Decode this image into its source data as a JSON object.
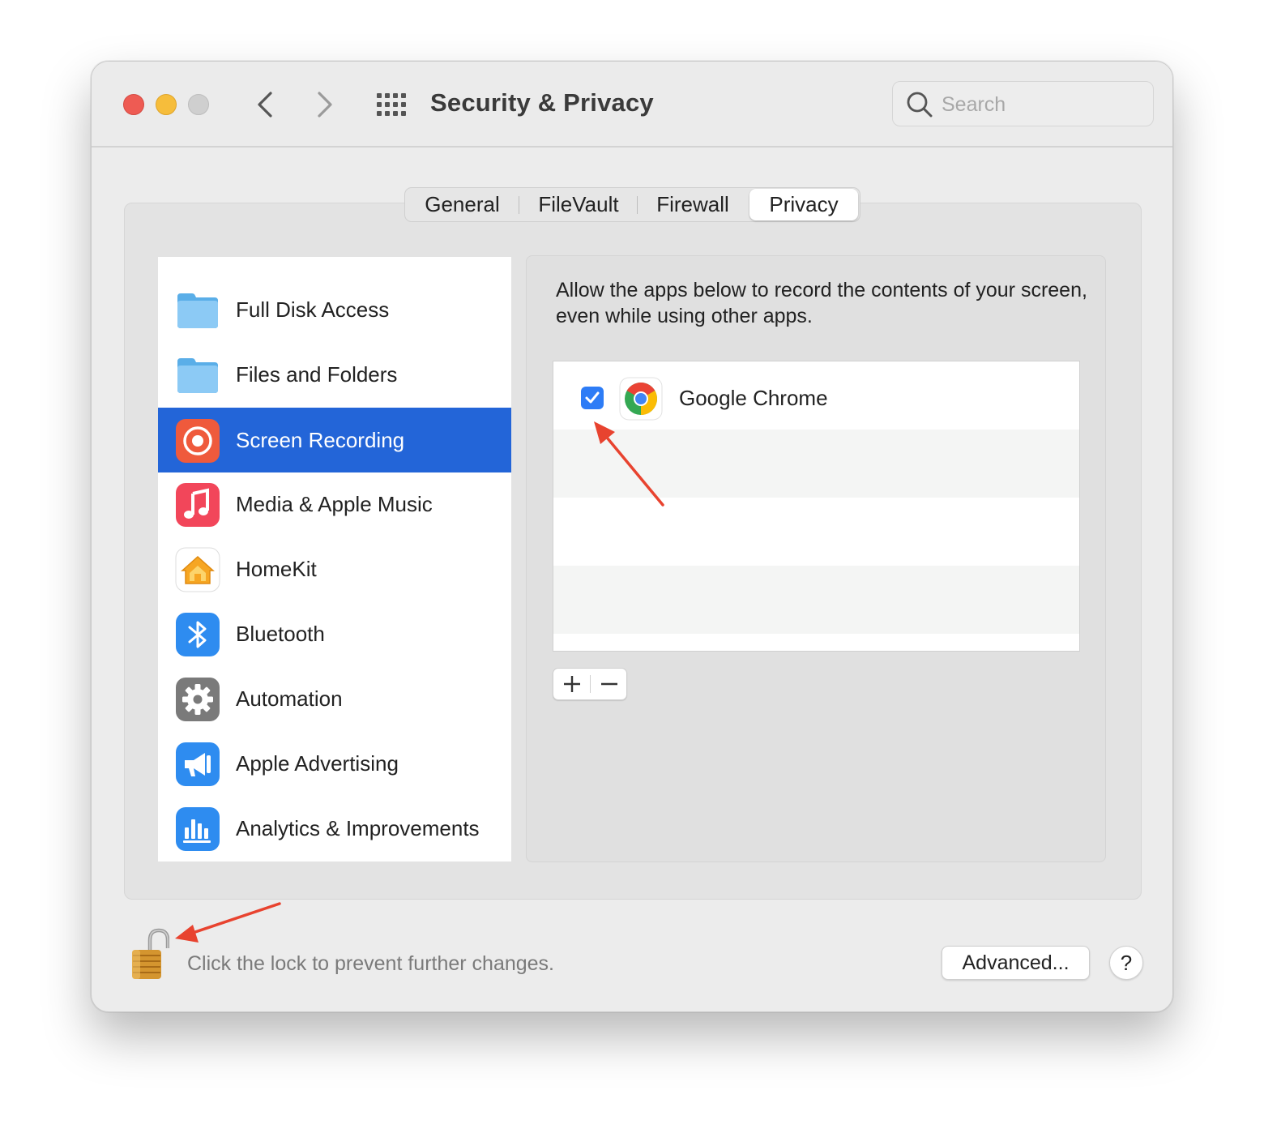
{
  "window": {
    "title": "Security & Privacy",
    "search": {
      "placeholder": "Search",
      "value": ""
    }
  },
  "tabs": [
    {
      "label": "General",
      "active": false
    },
    {
      "label": "FileVault",
      "active": false
    },
    {
      "label": "Firewall",
      "active": false
    },
    {
      "label": "Privacy",
      "active": true
    }
  ],
  "sidebar": {
    "items": [
      {
        "label": "Full Disk Access",
        "icon": "folder-icon",
        "selected": false
      },
      {
        "label": "Files and Folders",
        "icon": "folder-icon",
        "selected": false
      },
      {
        "label": "Screen Recording",
        "icon": "screen-recording-icon",
        "selected": true
      },
      {
        "label": "Media & Apple Music",
        "icon": "music-icon",
        "selected": false
      },
      {
        "label": "HomeKit",
        "icon": "homekit-icon",
        "selected": false
      },
      {
        "label": "Bluetooth",
        "icon": "bluetooth-icon",
        "selected": false
      },
      {
        "label": "Automation",
        "icon": "gear-icon",
        "selected": false
      },
      {
        "label": "Apple Advertising",
        "icon": "megaphone-icon",
        "selected": false
      },
      {
        "label": "Analytics & Improvements",
        "icon": "analytics-icon",
        "selected": false
      }
    ]
  },
  "panel": {
    "description": "Allow the apps below to record the contents of your screen, even while using other apps.",
    "apps": [
      {
        "name": "Google Chrome",
        "checked": true,
        "icon": "chrome-icon"
      }
    ],
    "add_symbol": "+",
    "remove_symbol": "−"
  },
  "footer": {
    "lock_text": "Click the lock to prevent further changes.",
    "lock_state": "unlocked",
    "advanced_label": "Advanced...",
    "help_label": "?"
  },
  "colors": {
    "accent_selected": "#2365d8",
    "checkbox": "#2d7cf6",
    "annotation_arrow": "#e8432f",
    "close": "#ee5b53",
    "minimize": "#f6bd3b",
    "zoom": "#cfcfcf"
  }
}
